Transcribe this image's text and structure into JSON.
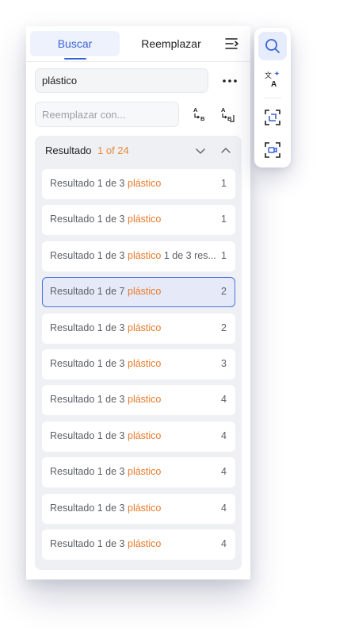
{
  "tabs": {
    "search": "Buscar",
    "replace": "Reemplazar"
  },
  "search": {
    "value": "plástico"
  },
  "replace": {
    "placeholder": "Reemplazar con..."
  },
  "results": {
    "title": "Resultado",
    "count": "1 of 24",
    "items": [
      {
        "prefix": "Resultado 1 de 3 ",
        "highlight": "plástico",
        "suffix": "",
        "page": "1"
      },
      {
        "prefix": "Resultado 1 de 3 ",
        "highlight": "plástico",
        "suffix": "",
        "page": "1"
      },
      {
        "prefix": "Resultado 1 de 3 ",
        "highlight": "plástico",
        "suffix": " 1 de 3 res...",
        "page": "1"
      },
      {
        "prefix": "Resultado 1 de 7 ",
        "highlight": "plástico",
        "suffix": "",
        "page": "2"
      },
      {
        "prefix": "Resultado 1 de 3 ",
        "highlight": "plástico",
        "suffix": "",
        "page": "2"
      },
      {
        "prefix": "Resultado 1 de 3 ",
        "highlight": "plástico",
        "suffix": "",
        "page": "3"
      },
      {
        "prefix": "Resultado 1 de 3 ",
        "highlight": "plástico",
        "suffix": "",
        "page": "4"
      },
      {
        "prefix": "Resultado 1 de 3 ",
        "highlight": "plástico",
        "suffix": "",
        "page": "4"
      },
      {
        "prefix": "Resultado 1 de 3 ",
        "highlight": "plástico",
        "suffix": "",
        "page": "4"
      },
      {
        "prefix": "Resultado 1 de 3 ",
        "highlight": "plástico",
        "suffix": "",
        "page": "4"
      },
      {
        "prefix": "Resultado 1 de 3 ",
        "highlight": "plástico",
        "suffix": "",
        "page": "4"
      }
    ]
  },
  "icons": {
    "collapse": "collapse-panel-icon",
    "more": "more-horizontal-icon",
    "replace_one": "replace-icon",
    "replace_all": "replace-all-icon",
    "nav_down": "chevron-down-icon",
    "nav_up": "chevron-up-icon",
    "toolbar": [
      "search-icon",
      "translate-icon",
      "crop-icon",
      "screen-record-icon"
    ]
  },
  "colors": {
    "accent": "#3a63d6",
    "highlight": "#e8792a",
    "active_row_bg": "#e6eaf8",
    "active_row_border": "#4a72dd"
  }
}
